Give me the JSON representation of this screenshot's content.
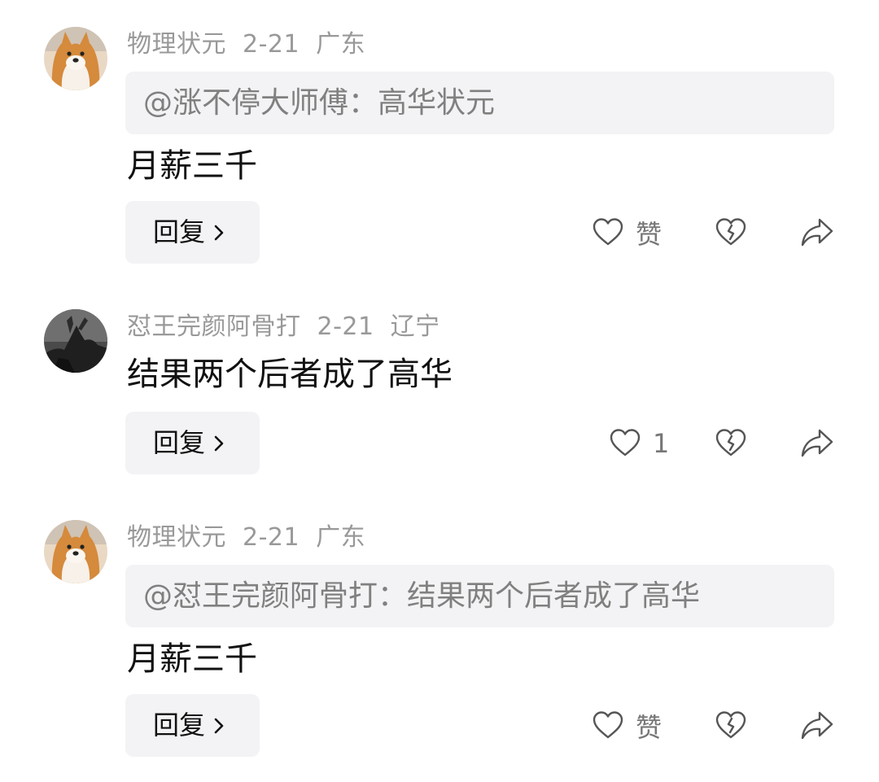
{
  "comments": [
    {
      "user": "物理状元",
      "date": "2-21",
      "location": "广东",
      "avatar": "shiba-dog-avatar",
      "quote": "@涨不停大师傅：高华状元",
      "text": "月薪三千",
      "reply_label": "回复",
      "like_label": "赞"
    },
    {
      "user": "怼王完颜阿骨打",
      "date": "2-21",
      "location": "辽宁",
      "avatar": "dark-statue-avatar",
      "text": "结果两个后者成了高华",
      "reply_label": "回复",
      "like_label": "1"
    },
    {
      "user": "物理状元",
      "date": "2-21",
      "location": "广东",
      "avatar": "shiba-dog-avatar",
      "quote": "@怼王完颜阿骨打：结果两个后者成了高华",
      "text": "月薪三千",
      "reply_label": "回复",
      "like_label": "赞"
    }
  ],
  "icons": {
    "like": "heart-icon",
    "dislike": "broken-heart-icon",
    "share": "share-arrow-icon",
    "reply_chevron": "chevron-right-icon"
  },
  "colors": {
    "meta_text": "#999999",
    "quote_bg": "#f3f3f5",
    "quote_text": "#808080"
  }
}
